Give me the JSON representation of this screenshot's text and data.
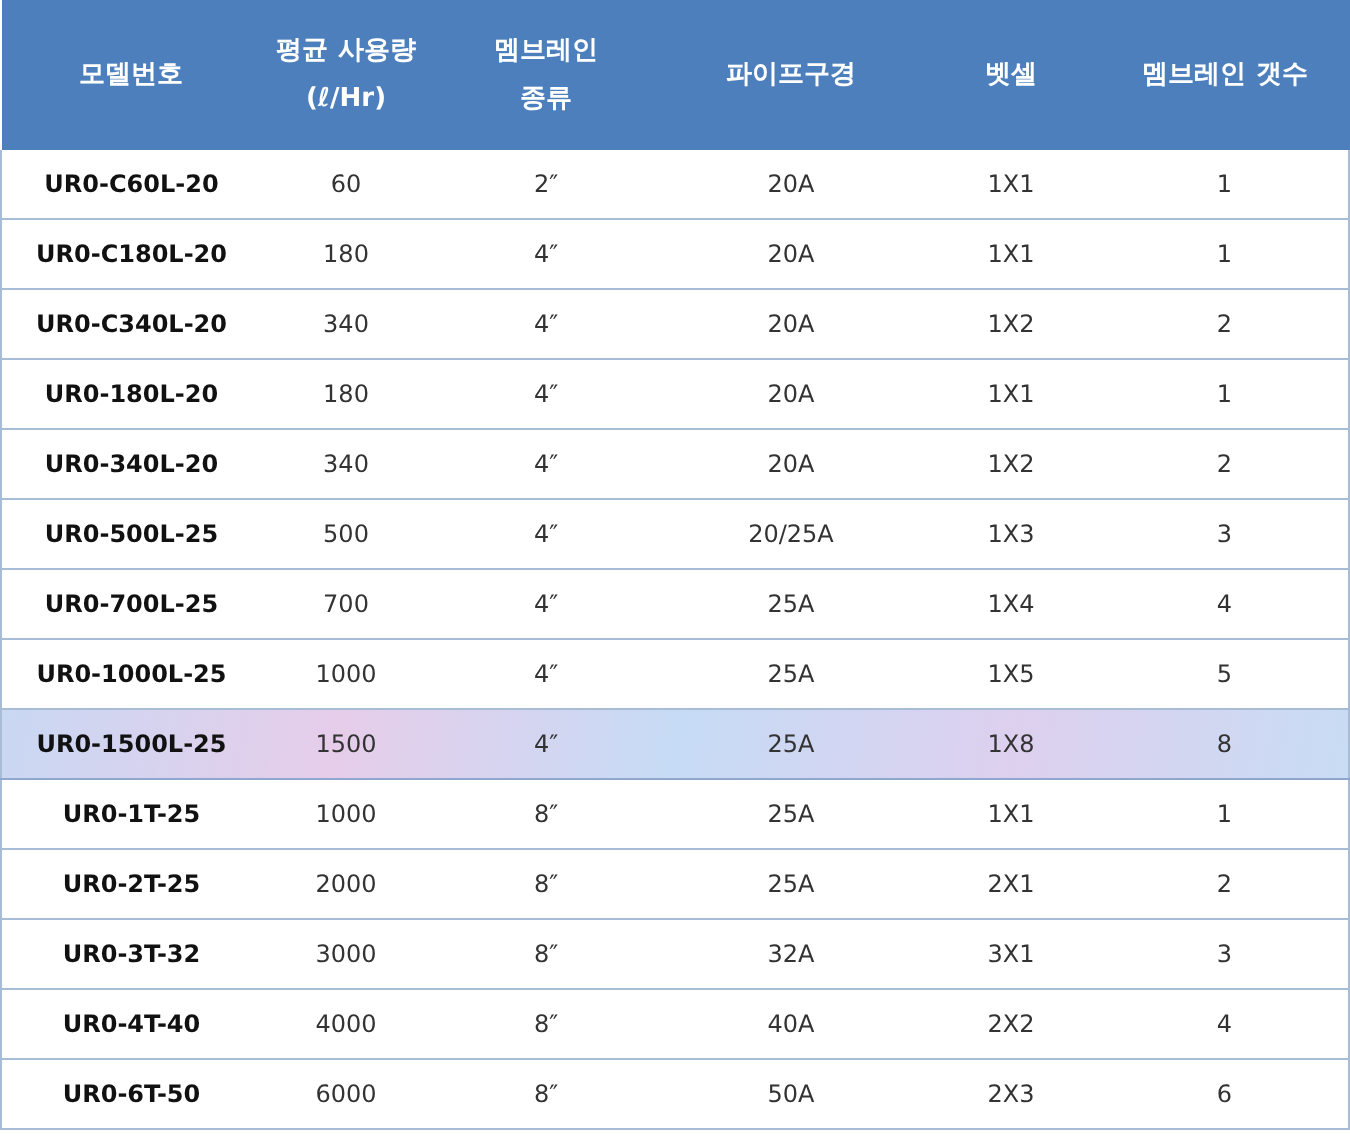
{
  "table": {
    "columns": [
      "모델번호",
      "평균 사용량\n(ℓ/Hr)",
      "멤브레인\n종류",
      "파이프구경",
      "벳셀",
      "멤브레인 갯수"
    ],
    "rows": [
      {
        "cells": [
          "UR0-C60L-20",
          "60",
          "2″",
          "20A",
          "1X1",
          "1"
        ],
        "selected": false
      },
      {
        "cells": [
          "UR0-C180L-20",
          "180",
          "4″",
          "20A",
          "1X1",
          "1"
        ],
        "selected": false
      },
      {
        "cells": [
          "UR0-C340L-20",
          "340",
          "4″",
          "20A",
          "1X2",
          "2"
        ],
        "selected": false
      },
      {
        "cells": [
          "UR0-180L-20",
          "180",
          "4″",
          "20A",
          "1X1",
          "1"
        ],
        "selected": false
      },
      {
        "cells": [
          "UR0-340L-20",
          "340",
          "4″",
          "20A",
          "1X2",
          "2"
        ],
        "selected": false
      },
      {
        "cells": [
          "UR0-500L-25",
          "500",
          "4″",
          "20/25A",
          "1X3",
          "3"
        ],
        "selected": false
      },
      {
        "cells": [
          "UR0-700L-25",
          "700",
          "4″",
          "25A",
          "1X4",
          "4"
        ],
        "selected": false
      },
      {
        "cells": [
          "UR0-1000L-25",
          "1000",
          "4″",
          "25A",
          "1X5",
          "5"
        ],
        "selected": false
      },
      {
        "cells": [
          "UR0-1500L-25",
          "1500",
          "4″",
          "25A",
          "1X8",
          "8"
        ],
        "selected": true
      },
      {
        "cells": [
          "UR0-1T-25",
          "1000",
          "8″",
          "25A",
          "1X1",
          "1"
        ],
        "selected": false
      },
      {
        "cells": [
          "UR0-2T-25",
          "2000",
          "8″",
          "25A",
          "2X1",
          "2"
        ],
        "selected": false
      },
      {
        "cells": [
          "UR0-3T-32",
          "3000",
          "8″",
          "32A",
          "3X1",
          "3"
        ],
        "selected": false
      },
      {
        "cells": [
          "UR0-4T-40",
          "4000",
          "8″",
          "40A",
          "2X2",
          "4"
        ],
        "selected": false
      },
      {
        "cells": [
          "UR0-6T-50",
          "6000",
          "8″",
          "50A",
          "2X3",
          "6"
        ],
        "selected": false
      }
    ]
  }
}
